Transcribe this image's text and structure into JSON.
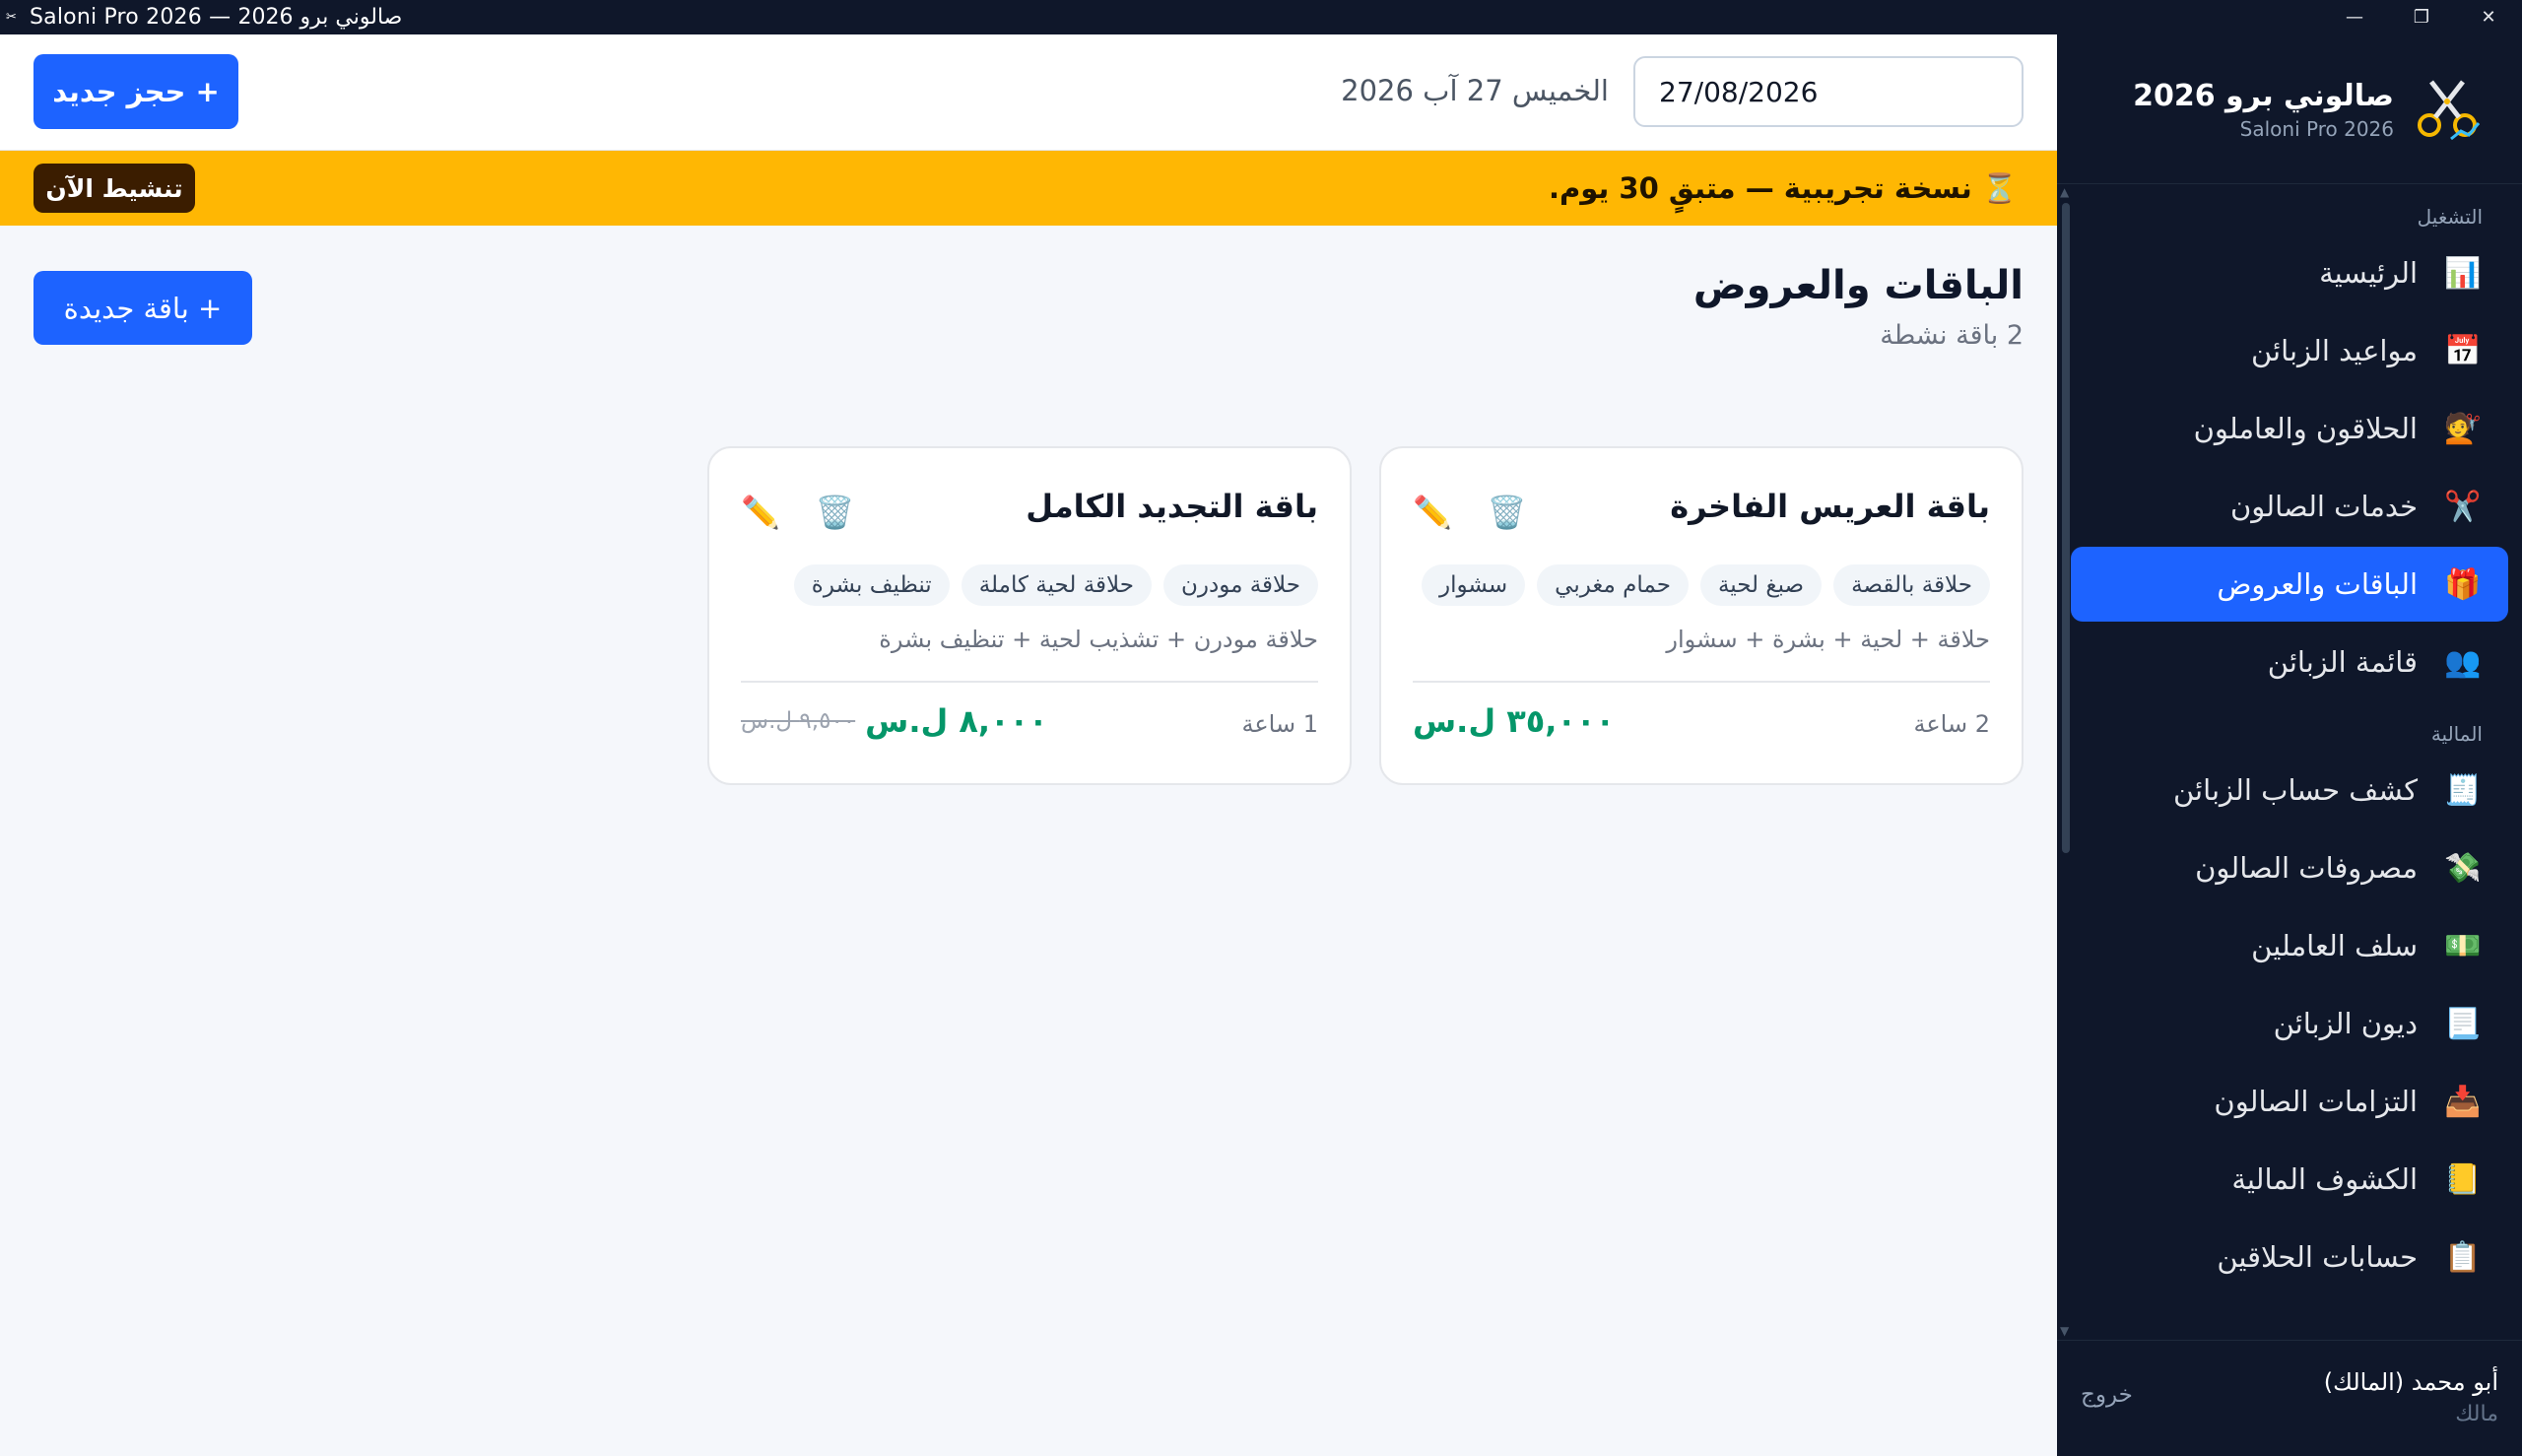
{
  "window": {
    "title": "Saloni Pro 2026 — صالوني برو 2026",
    "controls": [
      "—",
      "❐",
      "✕"
    ]
  },
  "brand": {
    "name_ar": "صالوني برو 2026",
    "name_en": "Saloni Pro 2026",
    "logo_icon": "scissors-chart-icon"
  },
  "sidebar": {
    "sections": [
      {
        "label": "التشغيل",
        "items": [
          {
            "label": "الرئيسية",
            "icon": "📊",
            "active": false
          },
          {
            "label": "مواعيد الزبائن",
            "icon": "📅",
            "active": false
          },
          {
            "label": "الحلاقون والعاملون",
            "icon": "💇",
            "active": false
          },
          {
            "label": "خدمات الصالون",
            "icon": "✂️",
            "active": false
          },
          {
            "label": "الباقات والعروض",
            "icon": "🎁",
            "active": true
          },
          {
            "label": "قائمة الزبائن",
            "icon": "👥",
            "active": false
          }
        ]
      },
      {
        "label": "المالية",
        "items": [
          {
            "label": "كشف حساب الزبائن",
            "icon": "🧾",
            "active": false
          },
          {
            "label": "مصروفات الصالون",
            "icon": "💸",
            "active": false
          },
          {
            "label": "سلف العاملين",
            "icon": "💵",
            "active": false
          },
          {
            "label": "ديون الزبائن",
            "icon": "📃",
            "active": false
          },
          {
            "label": "التزامات الصالون",
            "icon": "📥",
            "active": false
          },
          {
            "label": "الكشوف المالية",
            "icon": "📒",
            "active": false
          },
          {
            "label": "حسابات الحلاقين",
            "icon": "📋",
            "active": false
          }
        ]
      }
    ],
    "footer": {
      "user": "أبو محمد (المالك)",
      "role": "مالك",
      "logout": "خروج"
    }
  },
  "topbar": {
    "date_value": "27/08/2026",
    "date_label": "الخميس 27 آب 2026",
    "new_booking": "+ حجز جديد"
  },
  "trial": {
    "icon": "⏳",
    "message": "نسخة تجريبية — متبقٍ 30 يوم.",
    "activate": "تنشيط الآن"
  },
  "page": {
    "title": "الباقات والعروض",
    "subtitle": "2 باقة نشطة",
    "new_package": "+ باقة جديدة"
  },
  "packages": [
    {
      "name": "باقة العريس الفاخرة",
      "tags": [
        "حلاقة بالقصة",
        "صبغ لحية",
        "حمام مغربي",
        "سشوار"
      ],
      "description": "حلاقة + لحية + بشرة + سشوار",
      "duration": "2 ساعة",
      "price": "٣٥,٠٠٠ ل.س",
      "old_price": ""
    },
    {
      "name": "باقة التجديد الكامل",
      "tags": [
        "حلاقة مودرن",
        "حلاقة لحية كاملة",
        "تنظيف بشرة"
      ],
      "description": "حلاقة مودرن + تشذيب لحية + تنظيف بشرة",
      "duration": "1 ساعة",
      "price": "٨,٠٠٠ ل.س",
      "old_price": "٩,٥٠٠ ل.س"
    }
  ],
  "colors": {
    "sidebar_bg": "#0f172a",
    "accent": "#1d63ff",
    "trial_bg": "#ffb703",
    "price": "#059669"
  }
}
